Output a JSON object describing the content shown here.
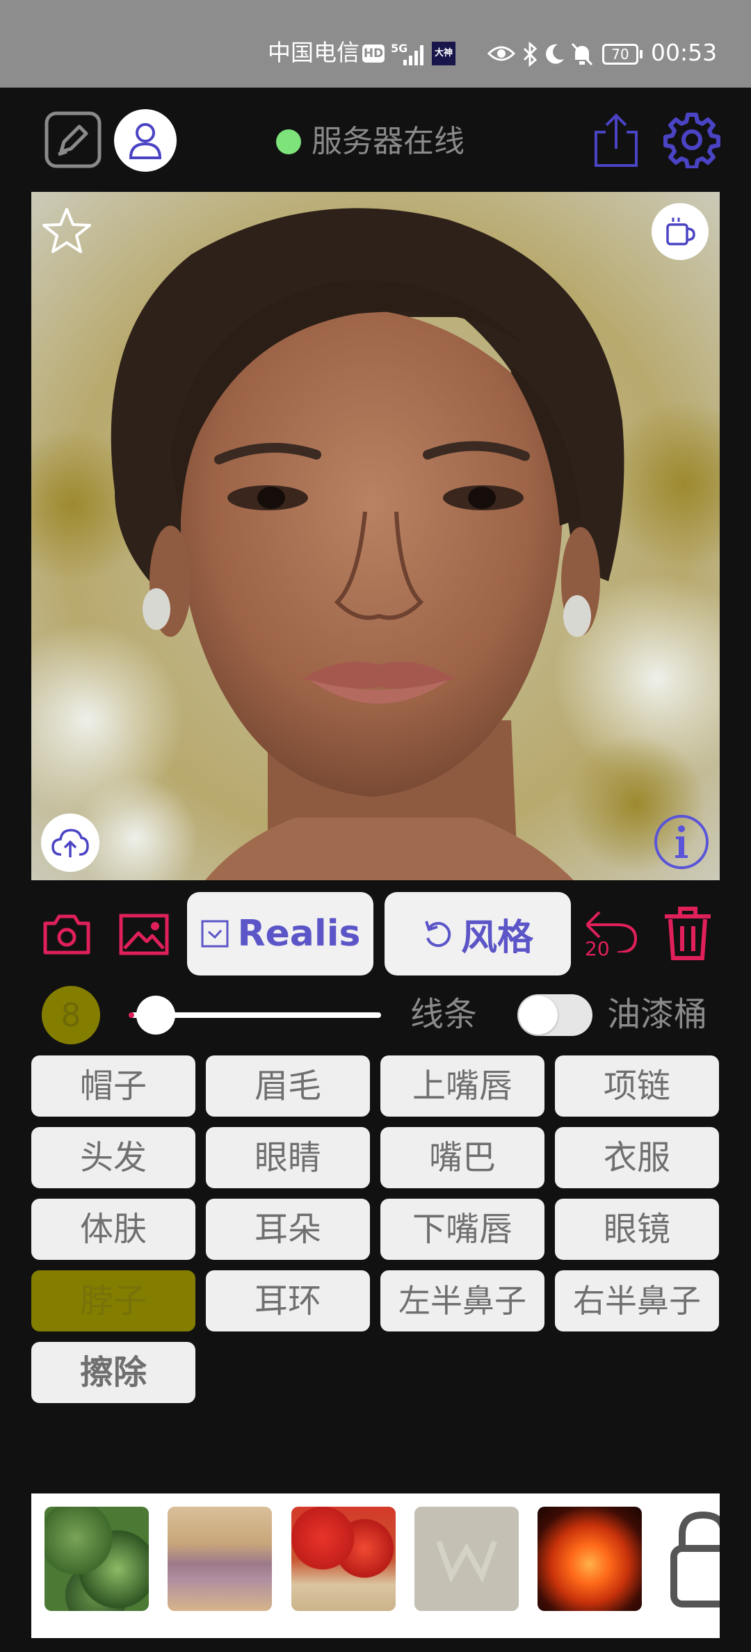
{
  "status_bar": {
    "carrier": "中国电信",
    "hd_badge": "HD",
    "network": "5G",
    "app_badge": "大神",
    "battery": "70",
    "time": "00:53"
  },
  "toolbar": {
    "server_status": "服务器在线",
    "server_status_color": "#7de37a",
    "accent_color": "#4a44c4"
  },
  "tools": {
    "mode_label": "Realis",
    "style_label": "风格",
    "undo_count": "20"
  },
  "brush": {
    "size": "8",
    "slider_value": 0.1,
    "line_label": "线条",
    "bucket_label": "油漆桶",
    "bucket_on": false
  },
  "parts": [
    {
      "label": "帽子",
      "selected": false
    },
    {
      "label": "眉毛",
      "selected": false
    },
    {
      "label": "上嘴唇",
      "selected": false
    },
    {
      "label": "项链",
      "selected": false
    },
    {
      "label": "头发",
      "selected": false
    },
    {
      "label": "眼睛",
      "selected": false
    },
    {
      "label": "嘴巴",
      "selected": false
    },
    {
      "label": "衣服",
      "selected": false
    },
    {
      "label": "体肤",
      "selected": false
    },
    {
      "label": "耳朵",
      "selected": false
    },
    {
      "label": "下嘴唇",
      "selected": false
    },
    {
      "label": "眼镜",
      "selected": false
    },
    {
      "label": "脖子",
      "selected": true
    },
    {
      "label": "耳环",
      "selected": false
    },
    {
      "label": "左半鼻子",
      "selected": false
    },
    {
      "label": "右半鼻子",
      "selected": false
    },
    {
      "label": "擦除",
      "selected": false
    }
  ],
  "textures": [
    {
      "name": "green-foliage-texture"
    },
    {
      "name": "lavender-field-texture"
    },
    {
      "name": "red-flower-tree-texture"
    },
    {
      "name": "watermark-placeholder-texture"
    },
    {
      "name": "fire-texture"
    },
    {
      "name": "locked-texture"
    }
  ]
}
